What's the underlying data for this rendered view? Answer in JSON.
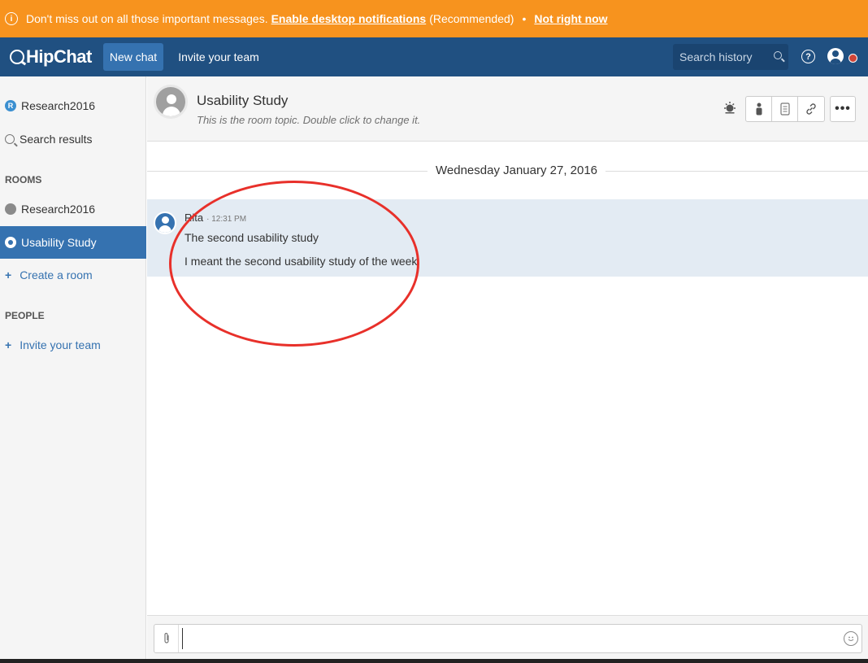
{
  "banner": {
    "info_icon": "info-icon",
    "message": "Don't miss out on all those important messages.",
    "enable_link": "Enable desktop notifications",
    "recommended": "(Recommended)",
    "separator": "•",
    "dismiss_link": "Not right now",
    "color": "#f7931e"
  },
  "topnav": {
    "logo": "HipChat",
    "new_chat": "New chat",
    "invite": "Invite your team",
    "search_placeholder": "Search history",
    "help": "?",
    "color": "#205081"
  },
  "sidebar": {
    "top_items": [
      {
        "label": "Research2016",
        "icon": "r-badge-icon",
        "badge": "R"
      },
      {
        "label": "Search results",
        "icon": "search-icon"
      }
    ],
    "rooms_heading": "ROOMS",
    "rooms": [
      {
        "label": "Research2016",
        "icon": "room-icon"
      },
      {
        "label": "Usability Study",
        "icon": "room-icon",
        "active": true
      }
    ],
    "create_room": "Create a room",
    "people_heading": "PEOPLE",
    "invite_team": "Invite your team",
    "plus": "+"
  },
  "room": {
    "title": "Usability Study",
    "topic": "This is the room topic. Double click to change it."
  },
  "messages": {
    "date": "Wednesday January 27, 2016",
    "items": [
      {
        "author": "Rita",
        "time": "· 12:31 PM",
        "lines": [
          "The second usability study",
          "I meant the second usability study of the week"
        ]
      }
    ]
  },
  "composer": {
    "value": ""
  }
}
